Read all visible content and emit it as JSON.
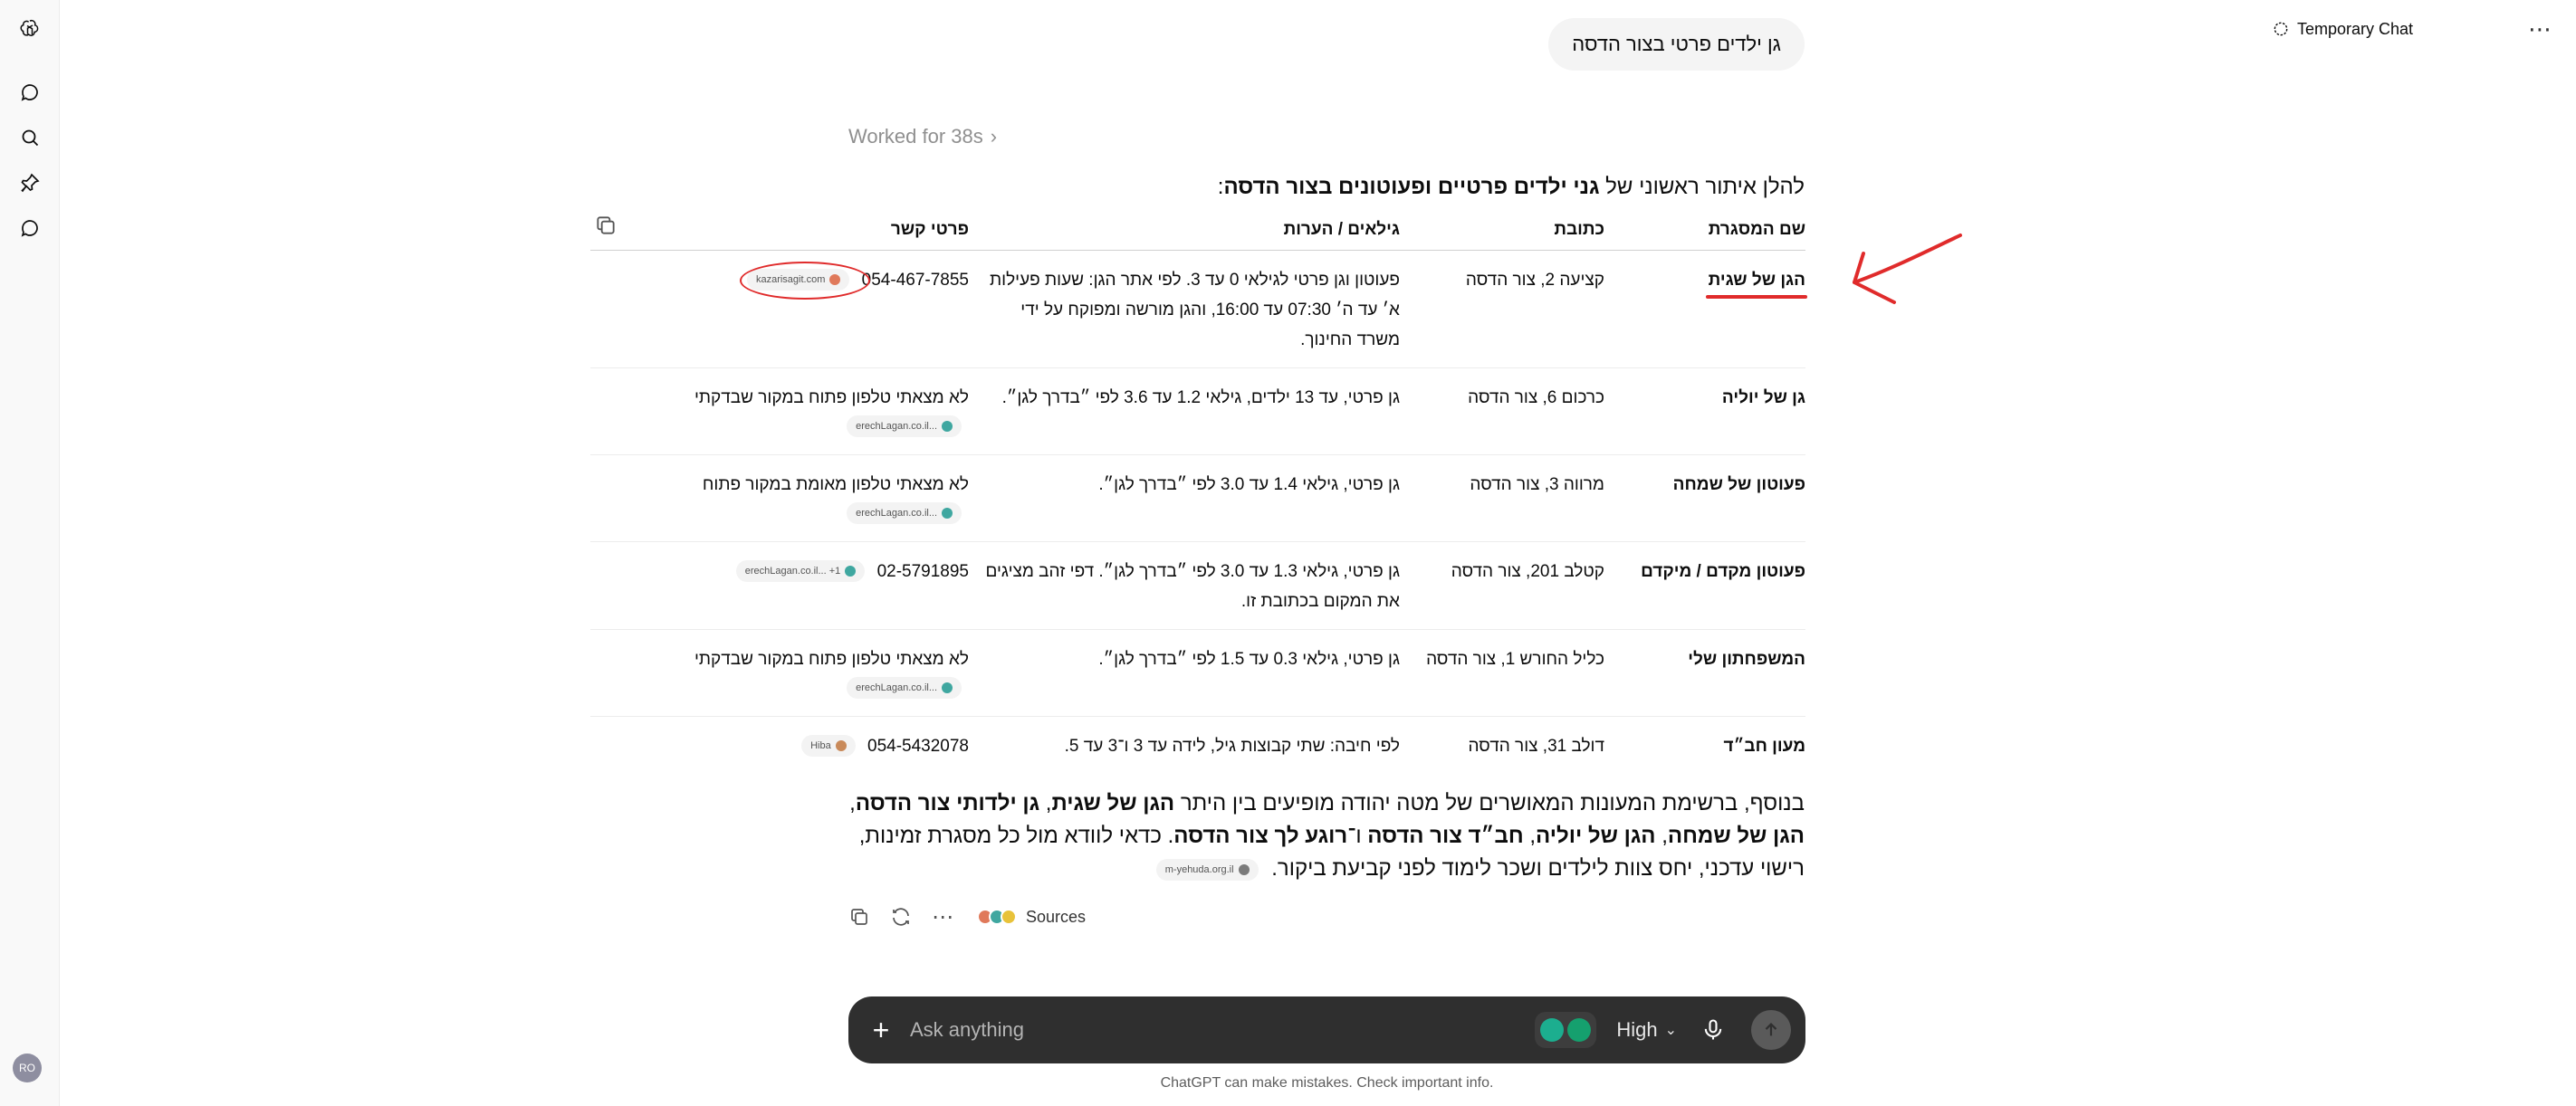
{
  "header": {
    "temporary_chat_label": "Temporary Chat"
  },
  "sidebar": {
    "avatar_initials": "RO"
  },
  "conversation": {
    "user_message": "גן ילדים פרטי בצור הדסה",
    "worked_label": "Worked for 38s",
    "intro_prefix": "להלן איתור ראשוני של ",
    "intro_bold": "גני ילדים פרטיים ופעוטונים בצור הדסה",
    "intro_suffix": ":",
    "table": {
      "headers": [
        "שם המסגרת",
        "כתובת",
        "גילאים / הערות",
        "פרטי קשר"
      ],
      "rows": [
        {
          "name": "הגן של שגית",
          "address": "קציעה 2, צור הדסה",
          "notes": "פעוטון וגן פרטי לגילאי 0 עד 3. לפי אתר הגן: שעות פעילות א׳ עד ה׳ 07:30 עד 16:00, והגן מורשה ומפוקח על ידי משרד החינוך.",
          "contact": "054-467-7855",
          "chip": "kazarisagit.com",
          "chip_color": "#e0795a"
        },
        {
          "name": "גן של יוליה",
          "address": "כרכום 6, צור הדסה",
          "notes": "גן פרטי, עד 13 ילדים, גילאי 1.2 עד 3.6 לפי ״בדרך לגן״.",
          "contact": "לא מצאתי טלפון פתוח במקור שבדקתי",
          "chip": "erechLagan.co.il...",
          "chip_color": "#3fa7a0"
        },
        {
          "name": "פעוטון של שמחה",
          "address": "מרווה 3, צור הדסה",
          "notes": "גן פרטי, גילאי 1.4 עד 3.0 לפי ״בדרך לגן״.",
          "contact": "לא מצאתי טלפון מאומת במקור פתוח",
          "chip": "erechLagan.co.il...",
          "chip_color": "#3fa7a0"
        },
        {
          "name": "פעוטון מקדם / מיקדם",
          "address": "קטלב 201, צור הדסה",
          "notes": "גן פרטי, גילאי 1.3 עד 3.0 לפי ״בדרך לגן״. דפי זהב מציגים את המקום בכתובת זו.",
          "contact": "02-5791895",
          "chip": "erechLagan.co.il... +1",
          "chip_color": "#3fa7a0"
        },
        {
          "name": "המשפחתון שלי",
          "address": "כליל החורש 1, צור הדסה",
          "notes": "גן פרטי, גילאי 0.3 עד 1.5 לפי ״בדרך לגן״.",
          "contact": "לא מצאתי טלפון פתוח במקור שבדקתי",
          "chip": "erechLagan.co.il...",
          "chip_color": "#3fa7a0"
        },
        {
          "name": "מעון חב״ד",
          "address": "דולב 31, צור הדסה",
          "notes": "לפי חיבה: שתי קבוצות גיל, לידה עד 3 ו־3 עד 5.",
          "contact": "054-5432078",
          "chip": "Hiba",
          "chip_color": "#c98a5a"
        }
      ]
    },
    "summary": {
      "p1": "בנוסף, ברשימת המעונות המאושרים של מטה יהודה מופיעים בין היתר ",
      "b1": "הגן של שגית",
      "p2": ", ",
      "b2": "גן ילדותי צור הדסה",
      "p3": ", ",
      "b3": "הגן של שמחה",
      "p4": ", ",
      "b4": "הגן של יוליה",
      "p5": ", ",
      "b5": "חב״ד צור הדסה",
      "p6": " ו־",
      "b6": "רוגע לך צור הדסה",
      "p7": ". כדאי לוודא מול כל מסגרת זמינות, רישוי עדכני, יחס צוות לילדים ושכר לימוד לפני קביעת ביקור.",
      "chip": "m-yehuda.org.il"
    },
    "sources_label": "Sources"
  },
  "composer": {
    "placeholder": "Ask anything",
    "model_label": "High"
  },
  "footer": {
    "disclaimer": "ChatGPT can make mistakes. Check important info."
  }
}
